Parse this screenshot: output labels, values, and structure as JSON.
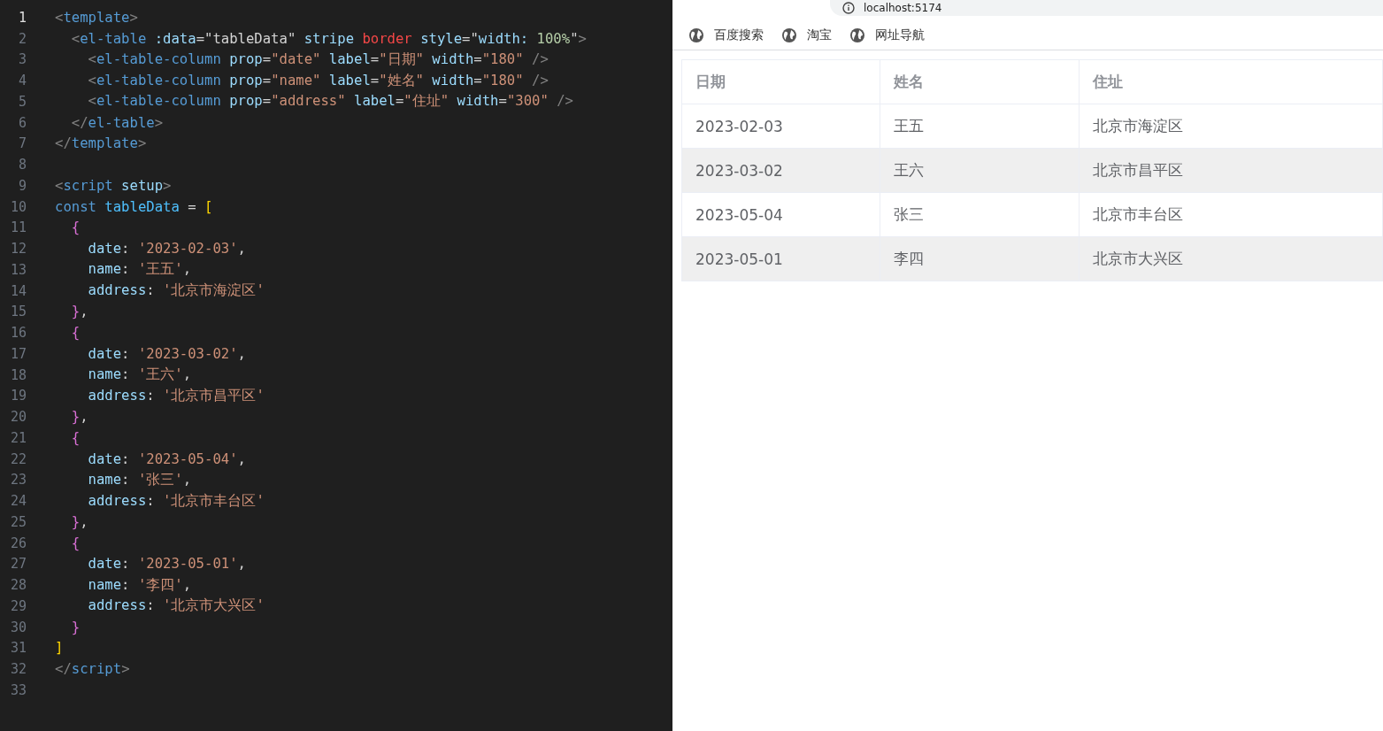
{
  "editor": {
    "lines": [
      {
        "number": "1",
        "active": true,
        "tokens": [
          {
            "kind": "punct",
            "text": "<"
          },
          {
            "kind": "tag",
            "text": "template"
          },
          {
            "kind": "punct",
            "text": ">"
          }
        ]
      },
      {
        "number": "2",
        "active": false,
        "tokens": [
          {
            "kind": "punct",
            "text": "  <"
          },
          {
            "kind": "tag",
            "text": "el-table "
          },
          {
            "kind": "attr",
            "text": ":data"
          },
          {
            "kind": "text",
            "text": "=\"tableData\" "
          },
          {
            "kind": "attr",
            "text": "stripe "
          },
          {
            "kind": "error",
            "text": "border "
          },
          {
            "kind": "attr",
            "text": "style"
          },
          {
            "kind": "text",
            "text": "=\""
          },
          {
            "kind": "attr",
            "text": "width: "
          },
          {
            "kind": "num",
            "text": "100%"
          },
          {
            "kind": "text",
            "text": "\""
          },
          {
            "kind": "punct",
            "text": ">"
          }
        ]
      },
      {
        "number": "3",
        "active": false,
        "tokens": [
          {
            "kind": "punct",
            "text": "    <"
          },
          {
            "kind": "tag",
            "text": "el-table-column "
          },
          {
            "kind": "attr",
            "text": "prop"
          },
          {
            "kind": "text",
            "text": "="
          },
          {
            "kind": "str",
            "text": "\"date\" "
          },
          {
            "kind": "attr",
            "text": "label"
          },
          {
            "kind": "text",
            "text": "="
          },
          {
            "kind": "str",
            "text": "\"日期\" "
          },
          {
            "kind": "attr",
            "text": "width"
          },
          {
            "kind": "text",
            "text": "="
          },
          {
            "kind": "str",
            "text": "\"180\" "
          },
          {
            "kind": "punct",
            "text": "/>"
          }
        ]
      },
      {
        "number": "4",
        "active": false,
        "tokens": [
          {
            "kind": "punct",
            "text": "    <"
          },
          {
            "kind": "tag",
            "text": "el-table-column "
          },
          {
            "kind": "attr",
            "text": "prop"
          },
          {
            "kind": "text",
            "text": "="
          },
          {
            "kind": "str",
            "text": "\"name\" "
          },
          {
            "kind": "attr",
            "text": "label"
          },
          {
            "kind": "text",
            "text": "="
          },
          {
            "kind": "str",
            "text": "\"姓名\" "
          },
          {
            "kind": "attr",
            "text": "width"
          },
          {
            "kind": "text",
            "text": "="
          },
          {
            "kind": "str",
            "text": "\"180\" "
          },
          {
            "kind": "punct",
            "text": "/>"
          }
        ]
      },
      {
        "number": "5",
        "active": false,
        "tokens": [
          {
            "kind": "punct",
            "text": "    <"
          },
          {
            "kind": "tag",
            "text": "el-table-column "
          },
          {
            "kind": "attr",
            "text": "prop"
          },
          {
            "kind": "text",
            "text": "="
          },
          {
            "kind": "str",
            "text": "\"address\" "
          },
          {
            "kind": "attr",
            "text": "label"
          },
          {
            "kind": "text",
            "text": "="
          },
          {
            "kind": "str",
            "text": "\"住址\" "
          },
          {
            "kind": "attr",
            "text": "width"
          },
          {
            "kind": "text",
            "text": "="
          },
          {
            "kind": "str",
            "text": "\"300\" "
          },
          {
            "kind": "punct",
            "text": "/>"
          }
        ]
      },
      {
        "number": "6",
        "active": false,
        "tokens": [
          {
            "kind": "punct",
            "text": "  </"
          },
          {
            "kind": "tag",
            "text": "el-table"
          },
          {
            "kind": "punct",
            "text": ">"
          }
        ]
      },
      {
        "number": "7",
        "active": false,
        "tokens": [
          {
            "kind": "punct",
            "text": "</"
          },
          {
            "kind": "tag",
            "text": "template"
          },
          {
            "kind": "punct",
            "text": ">"
          }
        ]
      },
      {
        "number": "8",
        "active": false
      },
      {
        "number": "9",
        "active": false,
        "tokens": [
          {
            "kind": "punct",
            "text": "<"
          },
          {
            "kind": "tag",
            "text": "script "
          },
          {
            "kind": "attr",
            "text": "setup"
          },
          {
            "kind": "punct",
            "text": ">"
          }
        ]
      },
      {
        "number": "10",
        "active": false,
        "tokens": [
          {
            "kind": "tag",
            "text": "const "
          },
          {
            "kind": "var",
            "text": "tableData "
          },
          {
            "kind": "text",
            "text": "= "
          },
          {
            "kind": "bracket1",
            "text": "["
          }
        ]
      },
      {
        "number": "11",
        "active": false,
        "tokens": [
          {
            "kind": "bracket2",
            "text": "  {"
          }
        ]
      },
      {
        "number": "12",
        "active": false,
        "tokens": [
          {
            "kind": "attr",
            "text": "    date"
          },
          {
            "kind": "text",
            "text": ": "
          },
          {
            "kind": "str",
            "text": "'2023-02-03'"
          },
          {
            "kind": "text",
            "text": ","
          }
        ]
      },
      {
        "number": "13",
        "active": false,
        "tokens": [
          {
            "kind": "attr",
            "text": "    name"
          },
          {
            "kind": "text",
            "text": ": "
          },
          {
            "kind": "str",
            "text": "'王五'"
          },
          {
            "kind": "text",
            "text": ","
          }
        ]
      },
      {
        "number": "14",
        "active": false,
        "tokens": [
          {
            "kind": "attr",
            "text": "    address"
          },
          {
            "kind": "text",
            "text": ": "
          },
          {
            "kind": "str",
            "text": "'北京市海淀区'"
          }
        ]
      },
      {
        "number": "15",
        "active": false,
        "tokens": [
          {
            "kind": "bracket2",
            "text": "  }"
          },
          {
            "kind": "text",
            "text": ","
          }
        ]
      },
      {
        "number": "16",
        "active": false,
        "tokens": [
          {
            "kind": "bracket2",
            "text": "  {"
          }
        ]
      },
      {
        "number": "17",
        "active": false,
        "tokens": [
          {
            "kind": "attr",
            "text": "    date"
          },
          {
            "kind": "text",
            "text": ": "
          },
          {
            "kind": "str",
            "text": "'2023-03-02'"
          },
          {
            "kind": "text",
            "text": ","
          }
        ]
      },
      {
        "number": "18",
        "active": false,
        "tokens": [
          {
            "kind": "attr",
            "text": "    name"
          },
          {
            "kind": "text",
            "text": ": "
          },
          {
            "kind": "str",
            "text": "'王六'"
          },
          {
            "kind": "text",
            "text": ","
          }
        ]
      },
      {
        "number": "19",
        "active": false,
        "tokens": [
          {
            "kind": "attr",
            "text": "    address"
          },
          {
            "kind": "text",
            "text": ": "
          },
          {
            "kind": "str",
            "text": "'北京市昌平区'"
          }
        ]
      },
      {
        "number": "20",
        "active": false,
        "tokens": [
          {
            "kind": "bracket2",
            "text": "  }"
          },
          {
            "kind": "text",
            "text": ","
          }
        ]
      },
      {
        "number": "21",
        "active": false,
        "tokens": [
          {
            "kind": "bracket2",
            "text": "  {"
          }
        ]
      },
      {
        "number": "22",
        "active": false,
        "tokens": [
          {
            "kind": "attr",
            "text": "    date"
          },
          {
            "kind": "text",
            "text": ": "
          },
          {
            "kind": "str",
            "text": "'2023-05-04'"
          },
          {
            "kind": "text",
            "text": ","
          }
        ]
      },
      {
        "number": "23",
        "active": false,
        "tokens": [
          {
            "kind": "attr",
            "text": "    name"
          },
          {
            "kind": "text",
            "text": ": "
          },
          {
            "kind": "str",
            "text": "'张三'"
          },
          {
            "kind": "text",
            "text": ","
          }
        ]
      },
      {
        "number": "24",
        "active": false,
        "tokens": [
          {
            "kind": "attr",
            "text": "    address"
          },
          {
            "kind": "text",
            "text": ": "
          },
          {
            "kind": "str",
            "text": "'北京市丰台区'"
          }
        ]
      },
      {
        "number": "25",
        "active": false,
        "tokens": [
          {
            "kind": "bracket2",
            "text": "  }"
          },
          {
            "kind": "text",
            "text": ","
          }
        ]
      },
      {
        "number": "26",
        "active": false,
        "tokens": [
          {
            "kind": "bracket2",
            "text": "  {"
          }
        ]
      },
      {
        "number": "27",
        "active": false,
        "tokens": [
          {
            "kind": "attr",
            "text": "    date"
          },
          {
            "kind": "text",
            "text": ": "
          },
          {
            "kind": "str",
            "text": "'2023-05-01'"
          },
          {
            "kind": "text",
            "text": ","
          }
        ]
      },
      {
        "number": "28",
        "active": false,
        "tokens": [
          {
            "kind": "attr",
            "text": "    name"
          },
          {
            "kind": "text",
            "text": ": "
          },
          {
            "kind": "str",
            "text": "'李四'"
          },
          {
            "kind": "text",
            "text": ","
          }
        ]
      },
      {
        "number": "29",
        "active": false,
        "tokens": [
          {
            "kind": "attr",
            "text": "    address"
          },
          {
            "kind": "text",
            "text": ": "
          },
          {
            "kind": "str",
            "text": "'北京市大兴区'"
          }
        ]
      },
      {
        "number": "30",
        "active": false,
        "tokens": [
          {
            "kind": "bracket2",
            "text": "  }"
          }
        ]
      },
      {
        "number": "31",
        "active": false,
        "tokens": [
          {
            "kind": "bracket1",
            "text": "]"
          }
        ]
      },
      {
        "number": "32",
        "active": false,
        "tokens": [
          {
            "kind": "punct",
            "text": "</"
          },
          {
            "kind": "tag",
            "text": "script"
          },
          {
            "kind": "punct",
            "text": ">"
          }
        ]
      },
      {
        "number": "33",
        "active": false
      }
    ]
  },
  "browser": {
    "address": "localhost:5174",
    "bookmarks": [
      "百度搜索",
      "淘宝",
      "网址导航"
    ],
    "table": {
      "columns": [
        "日期",
        "姓名",
        "住址"
      ],
      "rows": [
        {
          "striped": false,
          "cells": [
            "2023-02-03",
            "王五",
            "北京市海淀区"
          ]
        },
        {
          "striped": true,
          "cells": [
            "2023-03-02",
            "王六",
            "北京市昌平区"
          ]
        },
        {
          "striped": false,
          "cells": [
            "2023-05-04",
            "张三",
            "北京市丰台区"
          ]
        },
        {
          "striped": true,
          "cells": [
            "2023-05-01",
            "李四",
            "北京市大兴区"
          ]
        }
      ]
    }
  }
}
